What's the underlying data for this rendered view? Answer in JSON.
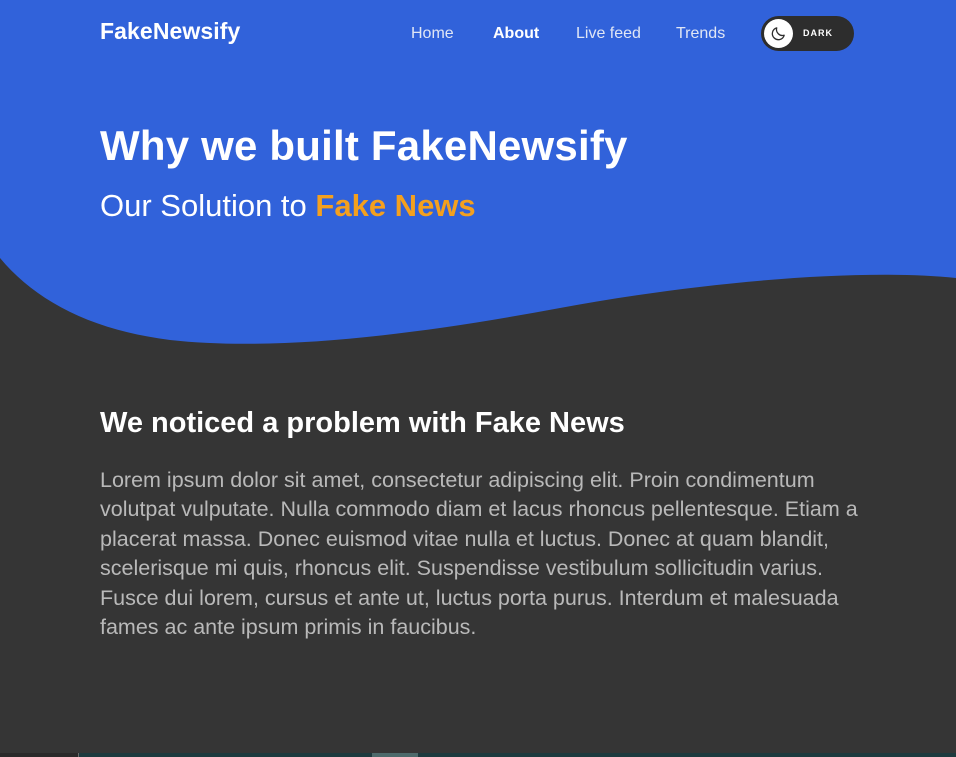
{
  "brand": {
    "logo": "FakeNewsify"
  },
  "nav": {
    "links": [
      {
        "label": "Home",
        "active": false
      },
      {
        "label": "About",
        "active": true
      },
      {
        "label": "Live feed",
        "active": false
      },
      {
        "label": "Trends",
        "active": false
      }
    ],
    "theme_toggle": {
      "label": "DARK",
      "icon": "moon-icon"
    }
  },
  "hero": {
    "title": "Why we built FakeNewsify",
    "subtitle_prefix": "Our Solution to ",
    "subtitle_accent": "Fake News"
  },
  "section": {
    "title": "We noticed a problem with Fake News",
    "body": "Lorem ipsum dolor sit amet, consectetur adipiscing elit. Proin condimentum volutpat vulputate. Nulla commodo diam et lacus rhoncus pellentesque. Etiam a placerat massa. Donec euismod vitae nulla et luctus. Donec at quam blandit, scelerisque mi quis, rhoncus elit. Suspendisse vestibulum sollicitudin varius. Fusce dui lorem, cursus et ante ut, luctus porta purus. Interdum et malesuada fames ac ante ipsum primis in faucibus."
  },
  "colors": {
    "hero_blue": "#3162da",
    "page_dark": "#353535",
    "accent_orange": "#f4a01e",
    "toggle_dark": "#2d2d2d"
  }
}
